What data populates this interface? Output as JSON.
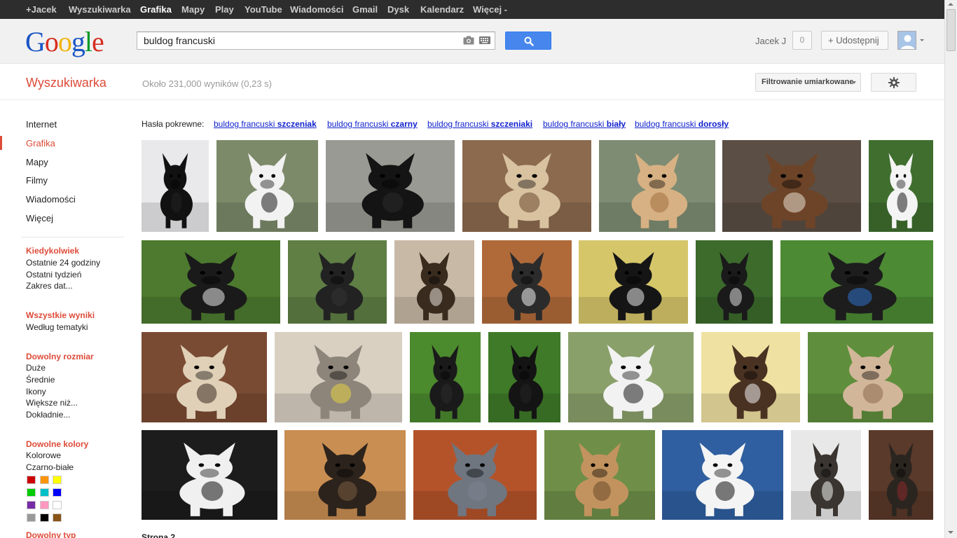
{
  "topbar": {
    "items": [
      {
        "label": "+Jacek",
        "active": false
      },
      {
        "label": "Wyszukiwarka",
        "active": false
      },
      {
        "label": "Grafika",
        "active": true
      },
      {
        "label": "Mapy",
        "active": false
      },
      {
        "label": "Play",
        "active": false
      },
      {
        "label": "YouTube",
        "active": false
      },
      {
        "label": "Wiadomości",
        "active": false
      },
      {
        "label": "Gmail",
        "active": false
      },
      {
        "label": "Dysk",
        "active": false
      },
      {
        "label": "Kalendarz",
        "active": false
      },
      {
        "label": "Więcej -",
        "active": false
      }
    ]
  },
  "header": {
    "logo_letters": [
      "G",
      "o",
      "o",
      "g",
      "l",
      "e"
    ],
    "logo_colors": [
      "#1a55c4",
      "#d62d20",
      "#f2b50f",
      "#1a55c4",
      "#009925",
      "#d62d20"
    ],
    "search_value": "buldog francuski",
    "user_name": "Jacek J",
    "notification_count": "0",
    "share_label": "+ Udostępnij",
    "icons": [
      "camera-icon",
      "keyboard-icon",
      "search-icon",
      "avatar",
      "gear-icon"
    ]
  },
  "subheader": {
    "section_title": "Wyszukiwarka",
    "result_count": "Około 231,000 wyników (0,23 s)",
    "filter_label": "Filtrowanie umiarkowane"
  },
  "leftnav": {
    "main_items": [
      {
        "label": "Internet",
        "active": false
      },
      {
        "label": "Grafika",
        "active": true
      },
      {
        "label": "Mapy",
        "active": false
      },
      {
        "label": "Filmy",
        "active": false
      },
      {
        "label": "Wiadomości",
        "active": false
      },
      {
        "label": "Więcej",
        "active": false
      }
    ],
    "time": {
      "heading": "Kiedykolwiek",
      "options": [
        "Ostatnie 24 godziny",
        "Ostatni tydzień",
        "Zakres dat..."
      ]
    },
    "results": {
      "heading": "Wszystkie wyniki",
      "options": [
        "Według tematyki"
      ]
    },
    "size": {
      "heading": "Dowolny rozmiar",
      "options": [
        "Duże",
        "Średnie",
        "Ikony",
        "Większe niż...",
        "Dokładnie..."
      ]
    },
    "colors": {
      "heading": "Dowolne kolory",
      "options": [
        "Kolorowe",
        "Czarno-białe"
      ],
      "swatches": [
        "#cc0000",
        "#fb940b",
        "#ffff00",
        "#00cc00",
        "#03c0c6",
        "#0000ff",
        "#762ca7",
        "#ff98bf",
        "#ffffff",
        "#999999",
        "#000000",
        "#885418"
      ]
    },
    "type": {
      "heading": "Dowolny typ"
    }
  },
  "related": {
    "label": "Hasła pokrewne:",
    "links": [
      {
        "prefix": "buldog francuski ",
        "bold": "szczeniak"
      },
      {
        "prefix": "buldog francuski ",
        "bold": "czarny"
      },
      {
        "prefix": "buldog francuski ",
        "bold": "szczeniaki"
      },
      {
        "prefix": "buldog francuski ",
        "bold": "biały"
      },
      {
        "prefix": "buldog francuski ",
        "bold": "dorosły"
      }
    ]
  },
  "page_label": "Strona 2"
}
